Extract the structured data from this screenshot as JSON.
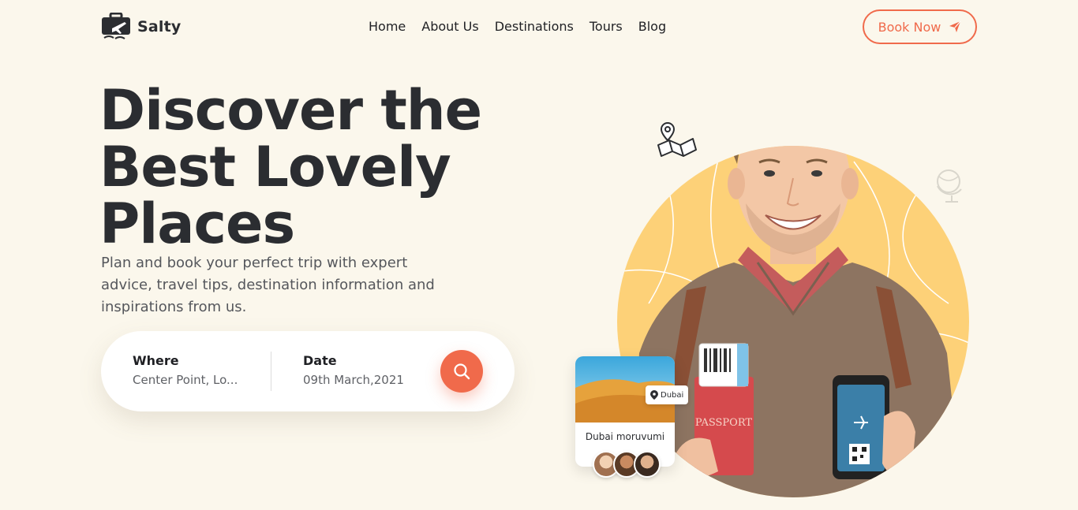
{
  "brand": {
    "name": "Salty"
  },
  "nav": {
    "items": [
      {
        "label": "Home"
      },
      {
        "label": "About Us"
      },
      {
        "label": "Destinations"
      },
      {
        "label": "Tours"
      },
      {
        "label": "Blog"
      }
    ]
  },
  "header": {
    "book_label": "Book Now",
    "book_icon": "paper-plane-icon"
  },
  "hero": {
    "title_lines": [
      "Discover the",
      "Best Lovely",
      "Places"
    ],
    "description": "Plan and book your perfect trip with expert advice, travel tips, destination information and inspirations from us."
  },
  "search": {
    "where_label": "Where",
    "where_value": "Center Point, Lo...",
    "date_label": "Date",
    "date_value": "09th March,2021",
    "search_icon": "search-icon"
  },
  "destination_card": {
    "pin_label": "Dubai",
    "name": "Dubai moruvumi",
    "avatar_count": 3
  },
  "illustration": {
    "passport_text": "PASSPORT"
  },
  "colors": {
    "accent": "#f06a4b",
    "background": "#fbf7ec",
    "circle": "#fdd178",
    "text_dark": "#2b2d31"
  }
}
